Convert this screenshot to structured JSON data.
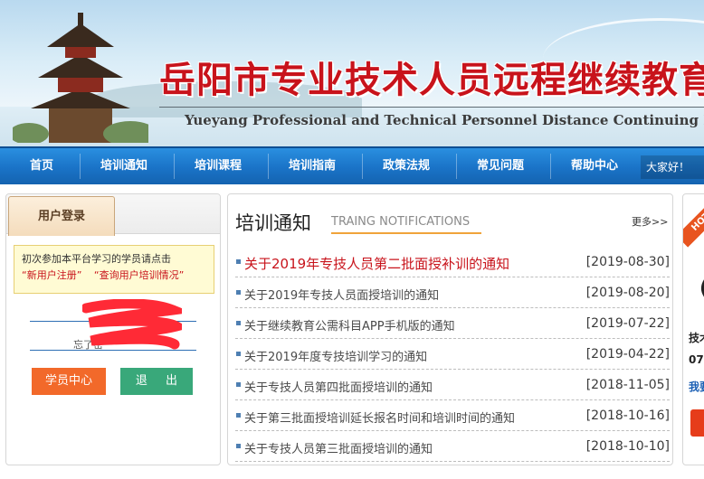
{
  "banner": {
    "title_cn": "岳阳市专业技术人员远程继续教育平",
    "title_en": "Yueyang Professional and Technical Personnel Distance Continuing Education Tr"
  },
  "nav": {
    "items": [
      "首页",
      "培训通知",
      "培训课程",
      "培训指南",
      "政策法规",
      "常见问题",
      "帮助中心"
    ],
    "greeting": "大家好！"
  },
  "login": {
    "tab_label": "用户登录",
    "notice_line1": "初次参加本平台学习的学员请点击",
    "register_link": "“新用户注册”",
    "query_link": "“查询用户培训情况”",
    "forgot_partial": "忘了密",
    "student_center_button": "学员中心",
    "logout_button": "退 出"
  },
  "notifications": {
    "title": "培训通知",
    "subtitle": "TRAING NOTIFICATIONS",
    "more": "更多>>",
    "items": [
      {
        "text": "关于2019年专技人员第二批面授补训的通知",
        "date": "[2019-08-30]",
        "hot": true
      },
      {
        "text": "关于2019年专技人员面授培训的通知",
        "date": "[2019-08-20]"
      },
      {
        "text": "关于继续教育公需科目APP手机版的通知",
        "date": "[2019-07-22]"
      },
      {
        "text": "关于2019年度专技培训学习的通知",
        "date": "[2019-04-22]"
      },
      {
        "text": "关于专技人员第四批面授培训的通知",
        "date": "[2018-11-05]"
      },
      {
        "text": "关于第三批面授培训延长报名时间和培训时间的通知",
        "date": "[2018-10-16]"
      },
      {
        "text": "关于专技人员第三批面授培训的通知",
        "date": "[2018-10-10]"
      }
    ]
  },
  "right_panel": {
    "ribbon": "HOT",
    "line1": "技术",
    "line2": "07",
    "link": "我要"
  },
  "colors": {
    "title_red": "#c8131b",
    "nav_blue": "#1a73c7",
    "orange_button": "#f2692a",
    "green_button": "#39a87a"
  }
}
